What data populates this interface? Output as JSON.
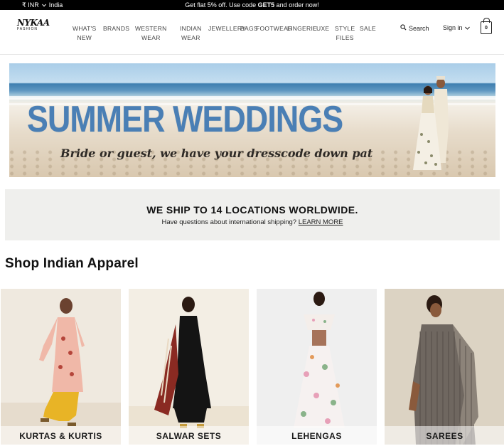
{
  "topbar": {
    "currency": "₹ INR",
    "region": "India",
    "promo_prefix": "Get flat 5% off. Use code ",
    "promo_code": "GET5",
    "promo_suffix": " and order now!"
  },
  "header": {
    "logo_top": "NYKAA",
    "logo_bottom": "FASHION",
    "nav": [
      {
        "line1": "WHAT'S",
        "line2": "NEW"
      },
      {
        "line1": "BRANDS",
        "line2": ""
      },
      {
        "line1": "WESTERN",
        "line2": "WEAR"
      },
      {
        "line1": "INDIAN",
        "line2": "WEAR"
      },
      {
        "line1": "JEWELLERY",
        "line2": ""
      },
      {
        "line1": "BAGS",
        "line2": ""
      },
      {
        "line1": "FOOTWEAR",
        "line2": ""
      },
      {
        "line1": "LINGERIE",
        "line2": ""
      },
      {
        "line1": "LUXE",
        "line2": ""
      },
      {
        "line1": "STYLE",
        "line2": "FILES"
      },
      {
        "line1": "SALE",
        "line2": ""
      }
    ],
    "search_label": "Search",
    "signin_label": "Sign in",
    "bag_count": "0"
  },
  "hero": {
    "title": "SUMMER WEDDINGS",
    "subtitle": "Bride or guest, we have your dresscode down pat"
  },
  "shipping": {
    "title": "WE SHIP TO 14 LOCATIONS WORLDWIDE.",
    "question": "Have questions about international shipping?",
    "link": "LEARN MORE"
  },
  "section": {
    "title": "Shop Indian Apparel"
  },
  "categories": [
    {
      "label": "KURTAS & KURTIS"
    },
    {
      "label": "SALWAR SETS"
    },
    {
      "label": "LEHENGAS"
    },
    {
      "label": "SAREES"
    }
  ],
  "icons": {
    "search": "magnifier",
    "signin_caret": "chevron-down",
    "bag": "shopping-bag",
    "locale_caret": "chevron-down"
  }
}
